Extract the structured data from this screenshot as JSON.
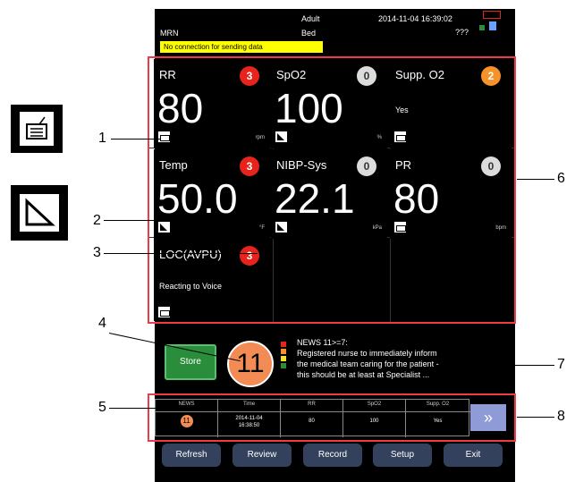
{
  "header": {
    "mrn": "MRN",
    "patient_type": "Adult",
    "bed": "Bed",
    "datetime": "2014-11-04 16:39:02",
    "unknown": "???",
    "warning": "No connection for sending data"
  },
  "params": [
    {
      "label": "RR",
      "score": "3",
      "value": "80",
      "unit": "rpm",
      "icon": "keyboard-icon"
    },
    {
      "label": "SpO2",
      "score": "0",
      "value": "100",
      "unit": "%",
      "icon": "manual-entry-icon"
    },
    {
      "label": "Supp. O2",
      "score": "2",
      "value": "Yes",
      "unit": "",
      "icon": "keyboard-icon"
    },
    {
      "label": "Temp",
      "score": "3",
      "value": "50.0",
      "unit": "°F",
      "icon": "manual-entry-icon"
    },
    {
      "label": "NIBP-Sys",
      "score": "0",
      "value": "22.1",
      "unit": "kPa",
      "icon": "manual-entry-icon"
    },
    {
      "label": "PR",
      "score": "0",
      "value": "80",
      "unit": "bpm",
      "icon": "keyboard-icon"
    },
    {
      "label": "LOC(AVPU)",
      "score": "3",
      "value": "Reacting to Voice",
      "unit": "",
      "icon": "keyboard-icon"
    }
  ],
  "store_label": "Store",
  "total_score": "11",
  "news_message": {
    "line1": "NEWS 11>=7:",
    "line2": "Registered nurse to immediately inform",
    "line3": "the medical team caring for the patient -",
    "line4": "this should be at least at Specialist ..."
  },
  "trend": {
    "headers": [
      "NEWS",
      "Time",
      "RR",
      "SpO2",
      "Supp. O2"
    ],
    "row": {
      "news": "11",
      "time1": "2014-11-04",
      "time2": "16:38:50",
      "rr": "80",
      "spo2": "100",
      "supp": "Yes"
    },
    "more": "»"
  },
  "buttons": [
    "Refresh",
    "Review",
    "Record",
    "Setup",
    "Exit"
  ],
  "callouts": [
    "1",
    "2",
    "3",
    "4",
    "5",
    "6",
    "7",
    "8"
  ],
  "colors": {
    "red": "#e8231c",
    "orange": "#f5922a",
    "store_green": "#2a8d3c",
    "frame_red": "#ee3b47"
  }
}
